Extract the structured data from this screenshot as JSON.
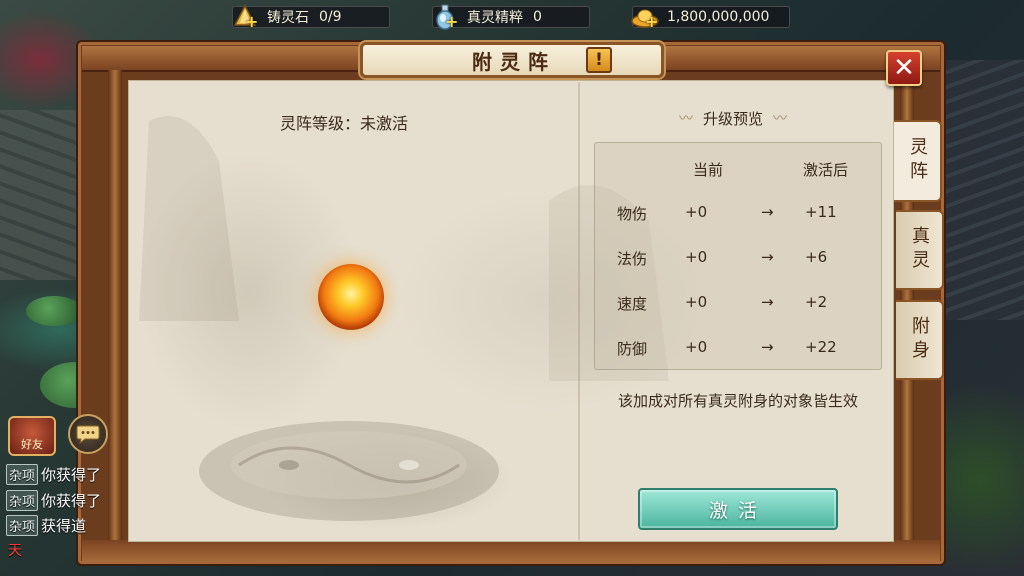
{
  "resources": [
    {
      "name": "铸灵石",
      "value": "0/9",
      "icon": "gold-stone-icon"
    },
    {
      "name": "真灵精粹",
      "value": "0",
      "icon": "spirit-vial-icon"
    },
    {
      "name": "",
      "value": "1,800,000,000",
      "icon": "gold-ingot-icon"
    }
  ],
  "dialog": {
    "title": "附灵阵",
    "info_label": "!",
    "close_label": "✕"
  },
  "left": {
    "level_label": "灵阵等级：未激活"
  },
  "preview": {
    "title": "升级预览",
    "col_current": "当前",
    "col_after": "激活后",
    "rows": [
      {
        "name": "物伤",
        "current": "+0",
        "arrow": "→",
        "after": "+11"
      },
      {
        "name": "法伤",
        "current": "+0",
        "arrow": "→",
        "after": "+6"
      },
      {
        "name": "速度",
        "current": "+0",
        "arrow": "→",
        "after": "+2"
      },
      {
        "name": "防御",
        "current": "+0",
        "arrow": "→",
        "after": "+22"
      }
    ],
    "note": "该加成对所有真灵附身的对象皆生效"
  },
  "activate_label": "激活",
  "tabs": [
    {
      "label": "灵阵",
      "active": true
    },
    {
      "label": "真灵",
      "active": false
    },
    {
      "label": "附身",
      "active": false
    }
  ],
  "chat": {
    "friend_label": "好友",
    "lines": [
      {
        "tag": "杂项",
        "text": "你获得了"
      },
      {
        "tag": "杂项",
        "text": "你获得了"
      },
      {
        "tag": "杂项",
        "text": "获得道"
      }
    ],
    "channel": "天"
  },
  "colors": {
    "frame": "#6b3d1e",
    "parchment": "#e6dfd0",
    "activate": "#4bb59f",
    "close": "#d6402f"
  }
}
